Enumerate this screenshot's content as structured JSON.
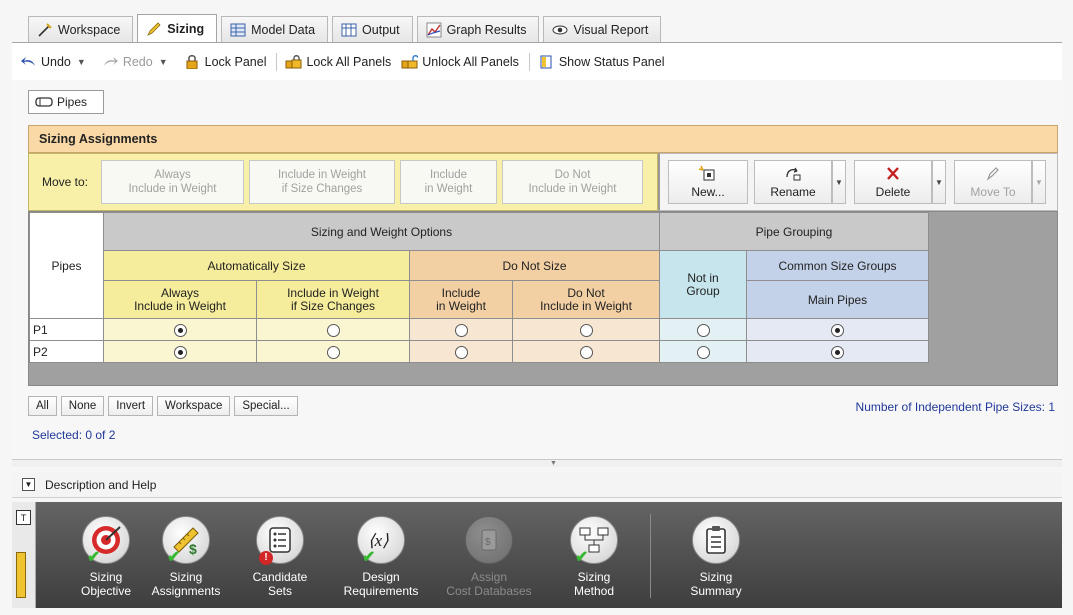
{
  "tabs": [
    {
      "label": "Workspace",
      "icon": "workspace-icon"
    },
    {
      "label": "Sizing",
      "icon": "pencil-icon"
    },
    {
      "label": "Model Data",
      "icon": "table-icon"
    },
    {
      "label": "Output",
      "icon": "output-grid-icon"
    },
    {
      "label": "Graph Results",
      "icon": "graph-icon"
    },
    {
      "label": "Visual Report",
      "icon": "eye-icon"
    }
  ],
  "toolbar": {
    "undo": "Undo",
    "redo": "Redo",
    "lock_panel": "Lock Panel",
    "lock_all": "Lock All Panels",
    "unlock_all": "Unlock All Panels",
    "show_status": "Show Status Panel"
  },
  "pipes_tab": "Pipes",
  "sizing_assignments": {
    "title": "Sizing Assignments",
    "move_to": "Move to:",
    "move_buttons": [
      {
        "line1": "Always",
        "line2": "Include in Weight"
      },
      {
        "line1": "Include in Weight",
        "line2": "if Size Changes"
      },
      {
        "line1": "Include",
        "line2": "in Weight"
      },
      {
        "line1": "Do Not",
        "line2": "Include in Weight"
      }
    ],
    "actions": {
      "new": "New...",
      "rename": "Rename",
      "delete": "Delete",
      "move_to": "Move To"
    }
  },
  "grid": {
    "pipes_header": "Pipes",
    "sizing_weight_options": "Sizing and Weight Options",
    "pipe_grouping": "Pipe Grouping",
    "automatically_size": "Automatically Size",
    "do_not_size": "Do Not Size",
    "not_in_group_1": "Not in",
    "not_in_group_2": "Group",
    "common_size_groups": "Common Size Groups",
    "main_pipes": "Main Pipes",
    "col_always_1": "Always",
    "col_always_2": "Include in Weight",
    "col_ifsize_1": "Include in Weight",
    "col_ifsize_2": "if Size Changes",
    "col_include_1": "Include",
    "col_include_2": "in Weight",
    "col_donot_1": "Do Not",
    "col_donot_2": "Include in Weight",
    "rows": [
      {
        "name": "P1",
        "sizing": [
          true,
          false,
          false,
          false
        ],
        "group": [
          false,
          true
        ]
      },
      {
        "name": "P2",
        "sizing": [
          true,
          false,
          false,
          false
        ],
        "group": [
          false,
          true
        ]
      }
    ]
  },
  "selection": {
    "buttons": [
      "All",
      "None",
      "Invert",
      "Workspace",
      "Special..."
    ],
    "selected": "Selected: 0 of 2",
    "independent": "Number of Independent Pipe Sizes: 1"
  },
  "description_help": "Description and Help",
  "ribbon": [
    {
      "line1": "Sizing",
      "line2": "Objective",
      "icon": "target-icon",
      "status": "check"
    },
    {
      "line1": "Sizing",
      "line2": "Assignments",
      "icon": "ruler-dollar-icon",
      "status": "check"
    },
    {
      "line1": "Candidate",
      "line2": "Sets",
      "icon": "list-icon",
      "status": "warning"
    },
    {
      "line1": "Design",
      "line2": "Requirements",
      "icon": "variable-x-icon",
      "status": "check"
    },
    {
      "line1": "Assign",
      "line2": "Cost Databases",
      "icon": "cost-database-icon",
      "status": "disabled"
    },
    {
      "line1": "Sizing",
      "line2": "Method",
      "icon": "flowchart-icon",
      "status": "check"
    },
    {
      "line1": "Sizing",
      "line2": "Summary",
      "icon": "clipboard-icon",
      "status": "none"
    }
  ]
}
